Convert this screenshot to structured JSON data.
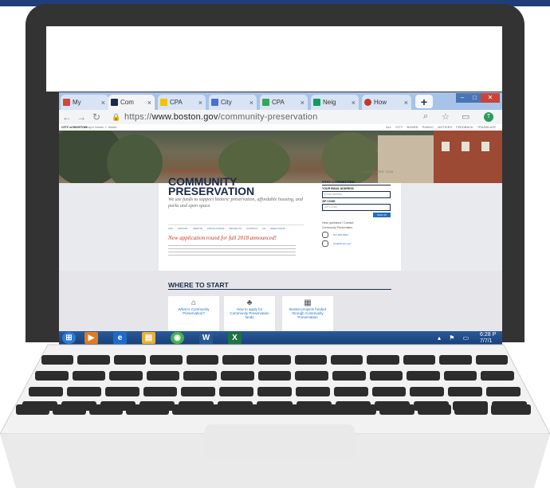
{
  "browser": {
    "tabs": [
      {
        "label": "My",
        "favicon_color": "#d44638"
      },
      {
        "label": "Com",
        "favicon_color": "#1b2a4a"
      },
      {
        "label": "CPA",
        "favicon_color": "#f2c200"
      },
      {
        "label": "City",
        "favicon_color": "#4a6fd1"
      },
      {
        "label": "CPA",
        "favicon_color": "#34a853"
      },
      {
        "label": "Neig",
        "favicon_color": "#0f9d58"
      },
      {
        "label": "How",
        "favicon_color": "#c0392b"
      }
    ],
    "tab_close": "×",
    "new_tab": "+",
    "url_prefix": "https://",
    "url_domain": "www.boston.gov",
    "url_path": "/community-preservation",
    "profile_initial": "T"
  },
  "site": {
    "logo": "CITY of BOSTON",
    "header_sub": "Mayor Martin J. Walsh",
    "header_links": "ALL CITY BOARD  PUBLIC NOTICES  FEEDBACK  TRANSLATE",
    "breadcrumbs": "HOME  COMMUNITY PRESERVATION",
    "updated": "LAST UPDATED: 7/1/18",
    "title": "COMMUNITY PRESERVATION",
    "tagline": "We use funds to support historic preservation, affordable housing, and parks and open space.",
    "subnav": "CPA HISTORY  GRANTS  APPLICATIONS  PROJECTS  CONTACT US  DIRECTIONS",
    "announcement": "New application round for fall 2018 announced!",
    "stay_connected": "STAY CONNECTED",
    "email_label": "YOUR EMAIL ADDRESS",
    "email_placeholder": "Email address",
    "zip_label": "ZIP CODE",
    "zip_placeholder": "ZIP CODE",
    "signup": "SIGN UP",
    "questions": "Have questions? Contact:",
    "contact_name": "Community Preservation",
    "phone": "617-635-0554",
    "email": "cpa@boston.gov",
    "where_to_start": "WHERE TO START",
    "cards": [
      {
        "icon": "house-icon",
        "label": "What is Community Preservation?"
      },
      {
        "icon": "tree-icon",
        "label": "How to apply for Community Preservation funds"
      },
      {
        "icon": "building-icon",
        "label": "Boston projects funded through Community Preservation"
      }
    ]
  },
  "taskbar": {
    "items": [
      {
        "name": "start-button",
        "glyph": "⊞",
        "color": "#2b7bd3"
      },
      {
        "name": "media-player",
        "glyph": "▶",
        "color": "#e07b20"
      },
      {
        "name": "ie-browser",
        "glyph": "e",
        "color": "#1d6cc6"
      },
      {
        "name": "file-explorer",
        "glyph": "▤",
        "color": "#e5b13a"
      },
      {
        "name": "chrome-browser",
        "glyph": "◉",
        "color": "#4caf50"
      },
      {
        "name": "word-app",
        "glyph": "W",
        "color": "#2b5797"
      },
      {
        "name": "excel-app",
        "glyph": "X",
        "color": "#1f7244"
      }
    ],
    "time": "6:28 P",
    "date": "7/7/1"
  }
}
